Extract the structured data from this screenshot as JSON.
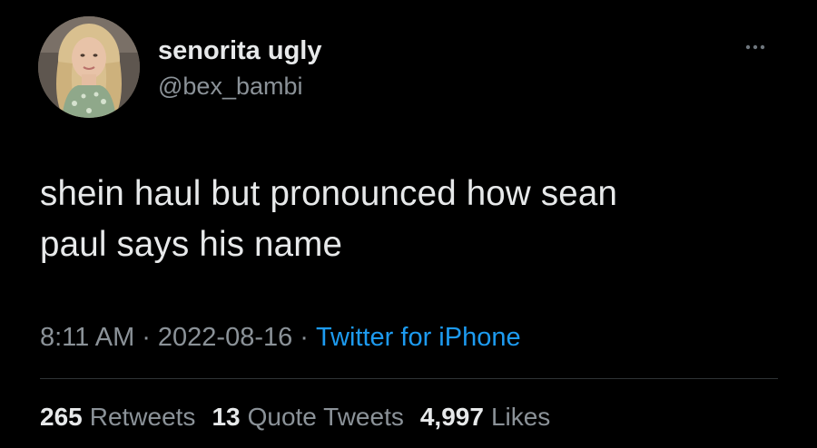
{
  "author": {
    "display_name": "senorita ugly",
    "handle": "@bex_bambi",
    "avatar_icon": "profile-photo"
  },
  "more_icon": "ellipsis-icon",
  "tweet": {
    "line1": "shein haul but pronounced how sean",
    "line2": "paul says his name"
  },
  "meta": {
    "time": "8:11 AM",
    "separator": "·",
    "date": "2022-08-16",
    "source": "Twitter for iPhone"
  },
  "stats": {
    "retweets_count": "265",
    "retweets_label": "Retweets",
    "quotes_count": "13",
    "quotes_label": "Quote Tweets",
    "likes_count": "4,997",
    "likes_label": "Likes"
  },
  "colors": {
    "background": "#000000",
    "text_primary": "#e7e9ea",
    "text_secondary": "#8b9298",
    "link": "#1d9bf0",
    "divider": "#2f3336"
  }
}
